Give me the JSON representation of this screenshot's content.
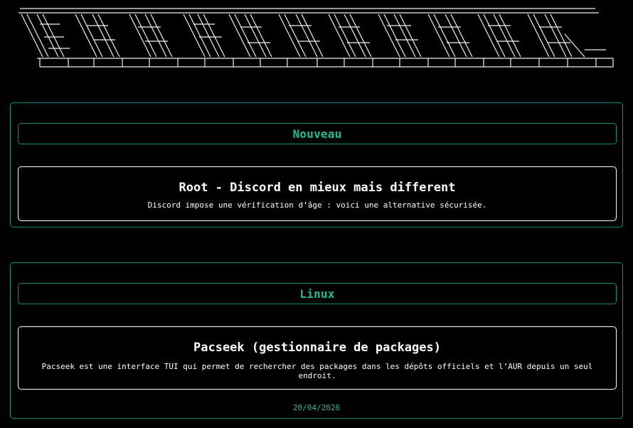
{
  "banner": {
    "logo_name": "ascii-art-logo"
  },
  "sections": [
    {
      "header": "Nouveau",
      "card": {
        "title": "Root - Discord en mieux mais different",
        "description": "Discord impose une vérification d’âge : voici une alternative sécurisée."
      }
    },
    {
      "header": "Linux",
      "card": {
        "title": "Pacseek (gestionnaire de packages)",
        "description": "Pacseek est une interface TUI qui permet de rechercher des packages dans les dépôts officiels et l’AUR depuis un seul endroit."
      },
      "date": "20/04/2026"
    }
  ],
  "colors": {
    "background": "#000000",
    "accent": "#26b99a",
    "border": "#1c8a74",
    "text": "#ffffff"
  }
}
